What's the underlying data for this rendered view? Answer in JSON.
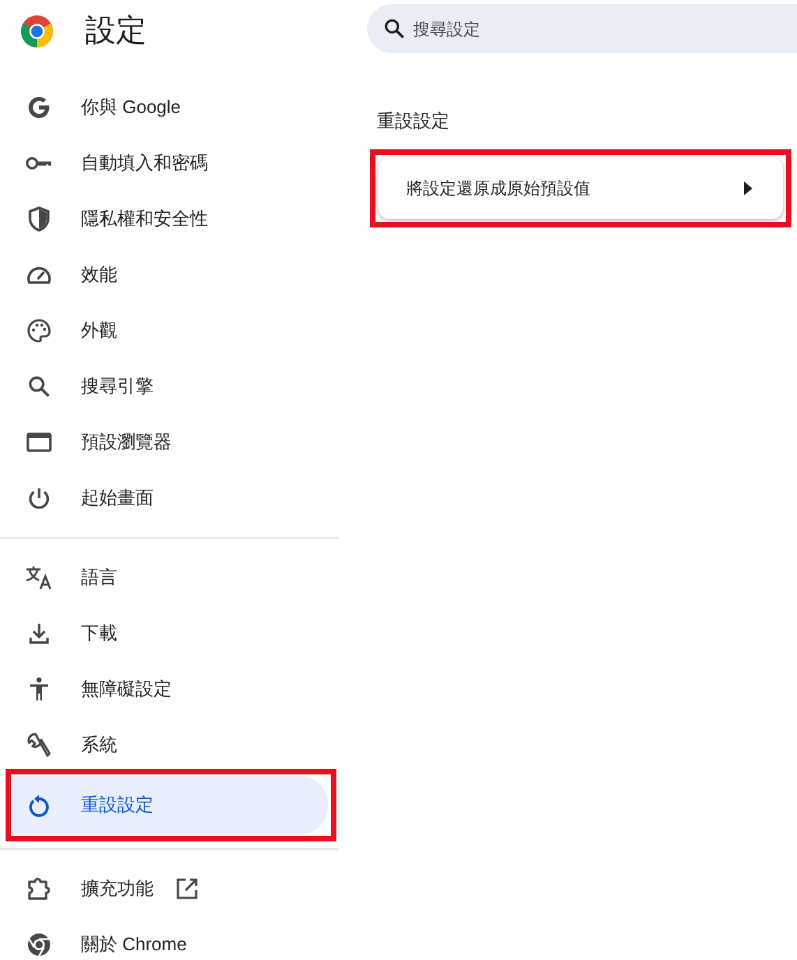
{
  "header": {
    "title": "設定"
  },
  "search": {
    "placeholder": "搜尋設定"
  },
  "sidebar": {
    "groups": [
      [
        {
          "label": "你與 Google",
          "selected": false,
          "highlighted": false,
          "external": false
        },
        {
          "label": "自動填入和密碼",
          "selected": false,
          "highlighted": false,
          "external": false
        },
        {
          "label": "隱私權和安全性",
          "selected": false,
          "highlighted": false,
          "external": false
        },
        {
          "label": "效能",
          "selected": false,
          "highlighted": false,
          "external": false
        },
        {
          "label": "外觀",
          "selected": false,
          "highlighted": false,
          "external": false
        },
        {
          "label": "搜尋引擎",
          "selected": false,
          "highlighted": false,
          "external": false
        },
        {
          "label": "預設瀏覽器",
          "selected": false,
          "highlighted": false,
          "external": false
        },
        {
          "label": "起始畫面",
          "selected": false,
          "highlighted": false,
          "external": false
        }
      ],
      [
        {
          "label": "語言",
          "selected": false,
          "highlighted": false,
          "external": false
        },
        {
          "label": "下載",
          "selected": false,
          "highlighted": false,
          "external": false
        },
        {
          "label": "無障礙設定",
          "selected": false,
          "highlighted": false,
          "external": false
        },
        {
          "label": "系統",
          "selected": false,
          "highlighted": false,
          "external": false
        },
        {
          "label": "重設設定",
          "selected": true,
          "highlighted": true,
          "external": false
        }
      ],
      [
        {
          "label": "擴充功能",
          "selected": false,
          "highlighted": false,
          "external": true
        },
        {
          "label": "關於 Chrome",
          "selected": false,
          "highlighted": false,
          "external": false
        }
      ]
    ]
  },
  "main": {
    "section_title": "重設設定",
    "rows": [
      {
        "label": "將設定還原成原始預設值",
        "highlighted": true
      }
    ]
  }
}
